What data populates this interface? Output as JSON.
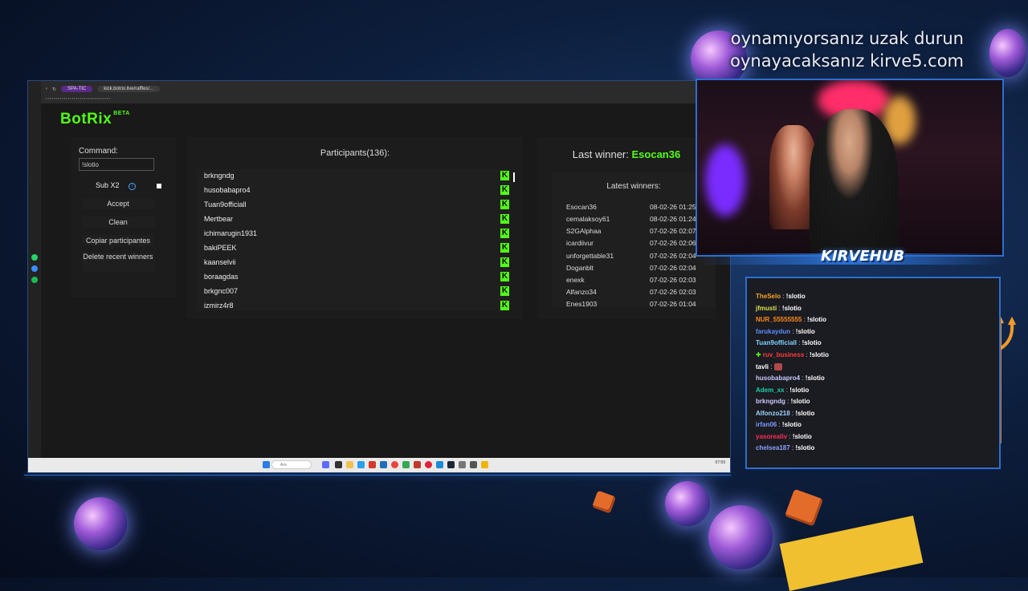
{
  "overlay": {
    "line1": "oynamıyorsanız uzak durun",
    "line2": "oynayacaksanız kirve5.com"
  },
  "browser": {
    "badge": "SPA-TIC",
    "url": "kick.botrix.live/raffles/..."
  },
  "botrix": {
    "logo": "BotRix",
    "beta": "BETA",
    "command_label": "Command:",
    "command_value": "!slotio",
    "sub_label": "Sub X2",
    "accept": "Accept",
    "clean": "Clean",
    "copy": "Copiar participantes",
    "delete": "Delete recent winners",
    "participants_title": "Participants(136):",
    "participants": [
      "brkngndg",
      "husobabapro4",
      "Tuan9officiall",
      "Mertbear",
      "ichimarugin1931",
      "bakiPEEK",
      "kaanselvii",
      "boraagdas",
      "brkgnc007",
      "izmirz4r8"
    ],
    "last_winner_label": "Last winner:",
    "last_winner_name": "Esocan36",
    "latest_winners_title": "Latest winners:",
    "winners": [
      {
        "name": "Esocan36",
        "date": "08-02-26 01:25"
      },
      {
        "name": "cemalaksoy61",
        "date": "08-02-26 01:24"
      },
      {
        "name": "S2GAlphaa",
        "date": "07-02-26 02:07"
      },
      {
        "name": "icardiivur",
        "date": "07-02-26 02:06"
      },
      {
        "name": "unforgettable31",
        "date": "07-02-26 02:04"
      },
      {
        "name": "Doganblt",
        "date": "07-02-26 02:04"
      },
      {
        "name": "enexk",
        "date": "07-02-26 02:03"
      },
      {
        "name": "Alfanzo34",
        "date": "07-02-26 02:03"
      },
      {
        "name": "Enes1903",
        "date": "07-02-26 01:04"
      }
    ]
  },
  "taskbar": {
    "search": "Ara",
    "clock": "07:59"
  },
  "cam": {
    "logo": "KIRVEHUB"
  },
  "chat": {
    "messages": [
      {
        "user": "TheSelo",
        "color": "#f5a623",
        "msg": "!slotio"
      },
      {
        "user": "jfmusti",
        "color": "#d9e24a",
        "msg": "!slotio"
      },
      {
        "user": "NUR_55555555",
        "color": "#ff8c1a",
        "msg": "!slotio"
      },
      {
        "user": "farukaydun",
        "color": "#5b8cff",
        "msg": "!slotio"
      },
      {
        "user": "Tuan9officiall",
        "color": "#7ed4ff",
        "msg": "!slotio"
      },
      {
        "user": "ruv_business",
        "color": "#ff3b3b",
        "msg": "!slotio",
        "badge": true
      },
      {
        "user": "tavli",
        "color": "#ffffff",
        "msg": "",
        "emote": true
      },
      {
        "user": "husobabapro4",
        "color": "#c9c9ff",
        "msg": "!slotio"
      },
      {
        "user": "Adem_xx",
        "color": "#19d1a8",
        "msg": "!slotio"
      },
      {
        "user": "brkngndg",
        "color": "#c9c9ff",
        "msg": "!slotio"
      },
      {
        "user": "Alfonzo218",
        "color": "#9ad4ff",
        "msg": "!slotio"
      },
      {
        "user": "irfan06",
        "color": "#7b9bff",
        "msg": "!slotio"
      },
      {
        "user": "yasorealiv",
        "color": "#ff2d55",
        "msg": "!slotio"
      },
      {
        "user": "chelsea187",
        "color": "#8aa2ff",
        "msg": "!slotio"
      }
    ]
  },
  "colors": {
    "kick_green": "#53fc18",
    "frame_blue": "#2c6fd0"
  }
}
